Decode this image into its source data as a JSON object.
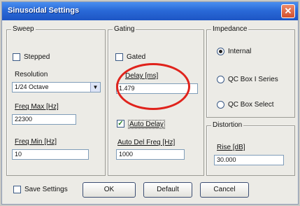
{
  "window": {
    "title": "Sinusoidal Settings"
  },
  "sweep": {
    "legend": "Sweep",
    "stepped_label": "Stepped",
    "resolution_label": "Resolution",
    "resolution_value": "1/24 Octave",
    "freq_max_label": "Freq Max [Hz]",
    "freq_max_value": "22300",
    "freq_min_label": "Freq Min [Hz]",
    "freq_min_value": "10"
  },
  "gating": {
    "legend": "Gating",
    "gated_label": "Gated",
    "delay_label": "Delay [ms]",
    "delay_value": "1.479",
    "auto_delay_label": "Auto Delay",
    "auto_del_freq_label": "Auto Del Freq [Hz]",
    "auto_del_freq_value": "1000"
  },
  "impedance": {
    "legend": "Impedance",
    "internal_label": "Internal",
    "qc_box_series_label": "QC Box I Series",
    "qc_box_select_label": "QC Box Select"
  },
  "distortion": {
    "legend": "Distortion",
    "rise_label": "Rise [dB]",
    "rise_value": "30.000"
  },
  "footer": {
    "save_settings_label": "Save Settings",
    "ok_label": "OK",
    "default_label": "Default",
    "cancel_label": "Cancel"
  },
  "annotation": {
    "ring_color": "#e0231c"
  }
}
